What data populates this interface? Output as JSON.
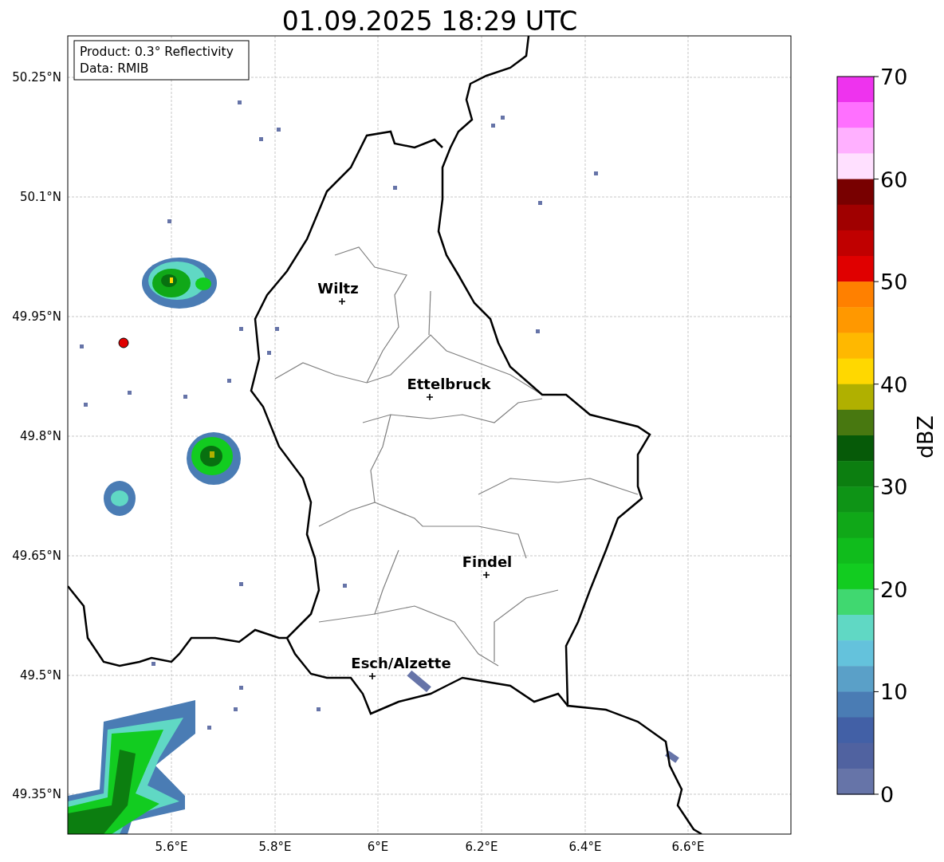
{
  "title": "01.09.2025 18:29 UTC",
  "info_box": [
    "Product: 0.3° Reflectivity",
    "Data: RMIB"
  ],
  "lat_ticks": [
    "50.25°N",
    "50.1°N",
    "49.95°N",
    "49.8°N",
    "49.65°N",
    "49.5°N",
    "49.35°N"
  ],
  "lon_ticks": [
    "5.6°E",
    "5.8°E",
    "6°E",
    "6.2°E",
    "6.4°E",
    "6.6°E"
  ],
  "cities": [
    {
      "name": "Wiltz"
    },
    {
      "name": "Ettelbruck"
    },
    {
      "name": "Findel"
    },
    {
      "name": "Esch/Alzette"
    }
  ],
  "colorbar": {
    "label": "dBZ",
    "ticks": [
      "70",
      "60",
      "50",
      "40",
      "30",
      "20",
      "10",
      "0"
    ],
    "bands": [
      {
        "color": "#ee33ee"
      },
      {
        "color": "#ff70ff"
      },
      {
        "color": "#ffb0ff"
      },
      {
        "color": "#ffe0ff"
      },
      {
        "color": "#780000"
      },
      {
        "color": "#a00000"
      },
      {
        "color": "#c00000"
      },
      {
        "color": "#e00000"
      },
      {
        "color": "#ff8000"
      },
      {
        "color": "#ff9800"
      },
      {
        "color": "#ffb800"
      },
      {
        "color": "#ffd800"
      },
      {
        "color": "#b0b000"
      },
      {
        "color": "#487810"
      },
      {
        "color": "#065a08"
      },
      {
        "color": "#0c7e10"
      },
      {
        "color": "#0e9416"
      },
      {
        "color": "#10a818"
      },
      {
        "color": "#10bc1c"
      },
      {
        "color": "#12cc20"
      },
      {
        "color": "#40d870"
      },
      {
        "color": "#60d8c4"
      },
      {
        "color": "#64c2dc"
      },
      {
        "color": "#5aa0c8"
      },
      {
        "color": "#4a7cb4"
      },
      {
        "color": "#4260a6"
      },
      {
        "color": "#5062a0"
      },
      {
        "color": "#6674a8"
      }
    ]
  }
}
